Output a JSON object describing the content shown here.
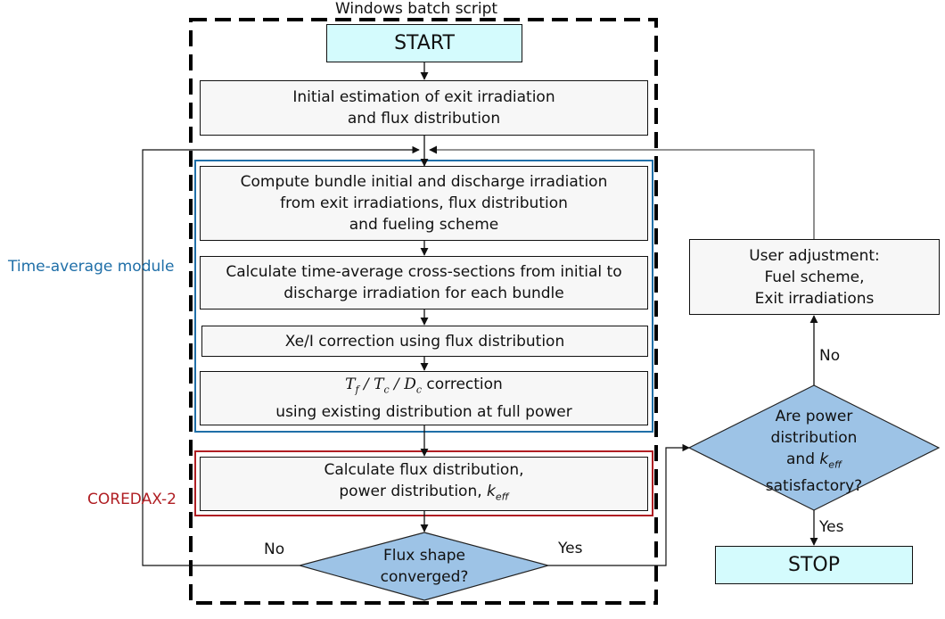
{
  "container_label": "Windows batch script",
  "groups": {
    "time_average": {
      "label": "Time-average module",
      "color": "#1f6fa8"
    },
    "coredax": {
      "label": "COREDAX-2",
      "color": "#b01e23"
    }
  },
  "nodes": {
    "start": "START",
    "initial": [
      "Initial estimation of exit irradiation",
      "and flux distribution"
    ],
    "compute_bundle": [
      "Compute bundle initial and discharge irradiation",
      "from exit irradiations, flux distribution",
      "and fueling scheme"
    ],
    "calc_xs": [
      "Calculate time-average cross-sections from initial to",
      "discharge irradiation for each bundle"
    ],
    "xe_correction": "Xe/I correction using flux distribution",
    "tf_correction": {
      "math": {
        "T": "T",
        "f": "f",
        "c": "c",
        "D": "D",
        "sep": " / "
      },
      "line1_suffix": " correction",
      "line2": "using existing distribution at full power"
    },
    "calc_flux": {
      "line1": "Calculate flux distribution,",
      "line2_prefix": "power distribution, ",
      "k": "k",
      "eff": "eff"
    },
    "flux_converged": [
      "Flux shape",
      "converged?"
    ],
    "satisfactory": {
      "line1": "Are power",
      "line2": "distribution",
      "line3_prefix": "and ",
      "k": "k",
      "eff": "eff",
      "line4": "satisfactory?"
    },
    "user_adjust": [
      "User adjustment:",
      "Fuel scheme,",
      "Exit irradiations"
    ],
    "stop": "STOP"
  },
  "edge_labels": {
    "flux_no": "No",
    "flux_yes": "Yes",
    "sat_no": "No",
    "sat_yes": "Yes"
  },
  "colors": {
    "terminal_fill": "#d4fbfd",
    "process_fill": "#f7f7f7",
    "decision_fill": "#9dc3e6"
  }
}
